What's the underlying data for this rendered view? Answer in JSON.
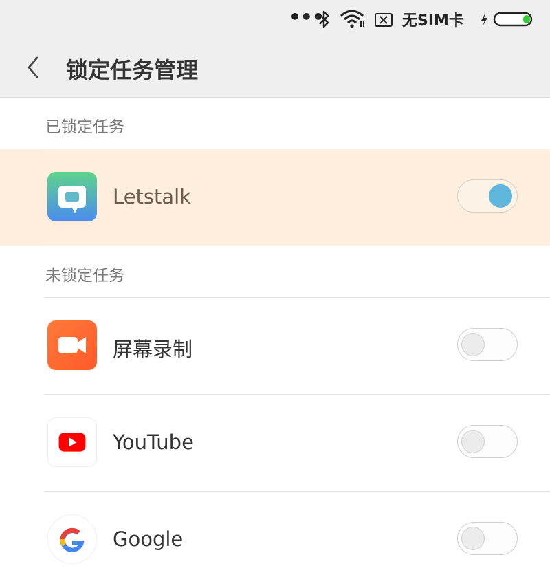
{
  "status_bar": {
    "dots": "•••",
    "bluetooth_icon": "bluetooth-icon",
    "wifi_icon": "wifi-icon",
    "nosim_icon": "no-sim-icon",
    "nosim_text": "无SIM卡",
    "charging_icon": "charging-icon",
    "battery_icon": "battery-icon",
    "battery_accent": "#33cc33"
  },
  "header": {
    "back_icon": "chevron-left-icon",
    "title": "锁定任务管理"
  },
  "sections": {
    "locked_title": "已锁定任务",
    "unlocked_title": "未锁定任务"
  },
  "locked_apps": [
    {
      "name": "Letstalk",
      "icon": "letstalk-icon",
      "locked": true
    }
  ],
  "unlocked_apps": [
    {
      "name": "屏幕录制",
      "icon": "screen-recorder-icon",
      "locked": false
    },
    {
      "name": "YouTube",
      "icon": "youtube-icon",
      "locked": false
    },
    {
      "name": "Google",
      "icon": "google-icon",
      "locked": false
    }
  ],
  "colors": {
    "locked_row_bg": "#fdeedd",
    "toggle_on": "#5fb6de",
    "youtube_red": "#ff0000",
    "recorder_orange": "#ff6a33"
  }
}
